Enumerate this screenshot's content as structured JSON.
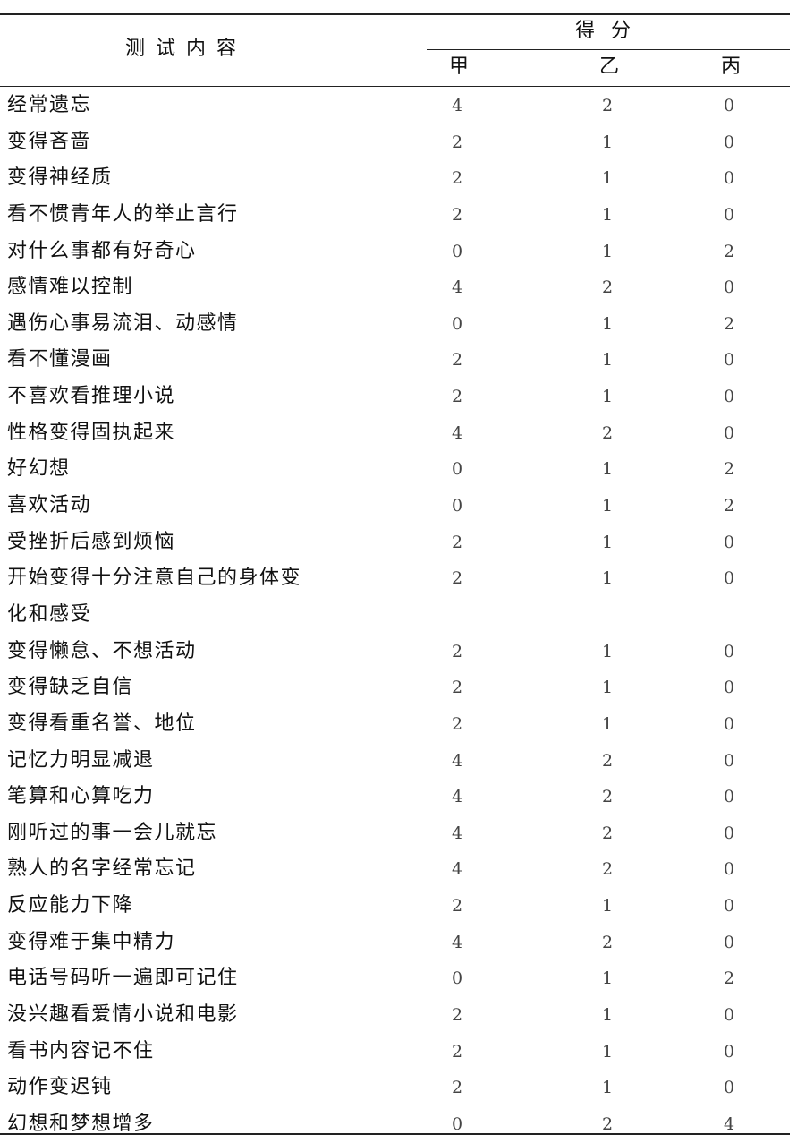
{
  "header": {
    "content_label": "测试内容",
    "score_label": "得分",
    "columns": [
      "甲",
      "乙",
      "丙"
    ]
  },
  "rows": [
    {
      "item": "经常遗忘",
      "jia": "4",
      "yi": "2",
      "bing": "0"
    },
    {
      "item": "变得吝啬",
      "jia": "2",
      "yi": "1",
      "bing": "0"
    },
    {
      "item": "变得神经质",
      "jia": "2",
      "yi": "1",
      "bing": "0"
    },
    {
      "item": "看不惯青年人的举止言行",
      "jia": "2",
      "yi": "1",
      "bing": "0"
    },
    {
      "item": "对什么事都有好奇心",
      "jia": "0",
      "yi": "1",
      "bing": "2"
    },
    {
      "item": "感情难以控制",
      "jia": "4",
      "yi": "2",
      "bing": "0"
    },
    {
      "item": "遇伤心事易流泪、动感情",
      "jia": "0",
      "yi": "1",
      "bing": "2"
    },
    {
      "item": "看不懂漫画",
      "jia": "2",
      "yi": "1",
      "bing": "0"
    },
    {
      "item": "不喜欢看推理小说",
      "jia": "2",
      "yi": "1",
      "bing": "0"
    },
    {
      "item": "性格变得固执起来",
      "jia": "4",
      "yi": "2",
      "bing": "0"
    },
    {
      "item": "好幻想",
      "jia": "0",
      "yi": "1",
      "bing": "2"
    },
    {
      "item": "喜欢活动",
      "jia": "0",
      "yi": "1",
      "bing": "2"
    },
    {
      "item": "受挫折后感到烦恼",
      "jia": "2",
      "yi": "1",
      "bing": "0"
    },
    {
      "item": "开始变得十分注意自己的身体变",
      "item_line2": "化和感受",
      "jia": "2",
      "yi": "1",
      "bing": "0"
    },
    {
      "item": "变得懒怠、不想活动",
      "jia": "2",
      "yi": "1",
      "bing": "0"
    },
    {
      "item": "变得缺乏自信",
      "jia": "2",
      "yi": "1",
      "bing": "0"
    },
    {
      "item": "变得看重名誉、地位",
      "jia": "2",
      "yi": "1",
      "bing": "0"
    },
    {
      "item": "记忆力明显减退",
      "jia": "4",
      "yi": "2",
      "bing": "0"
    },
    {
      "item": "笔算和心算吃力",
      "jia": "4",
      "yi": "2",
      "bing": "0"
    },
    {
      "item": "刚听过的事一会儿就忘",
      "jia": "4",
      "yi": "2",
      "bing": "0"
    },
    {
      "item": "熟人的名字经常忘记",
      "jia": "4",
      "yi": "2",
      "bing": "0"
    },
    {
      "item": "反应能力下降",
      "jia": "2",
      "yi": "1",
      "bing": "0"
    },
    {
      "item": "变得难于集中精力",
      "jia": "4",
      "yi": "2",
      "bing": "0"
    },
    {
      "item": "电话号码听一遍即可记住",
      "jia": "0",
      "yi": "1",
      "bing": "2"
    },
    {
      "item": "没兴趣看爱情小说和电影",
      "jia": "2",
      "yi": "1",
      "bing": "0"
    },
    {
      "item": "看书内容记不住",
      "jia": "2",
      "yi": "1",
      "bing": "0"
    },
    {
      "item": "动作变迟钝",
      "jia": "2",
      "yi": "1",
      "bing": "0"
    },
    {
      "item": "幻想和梦想增多",
      "jia": "0",
      "yi": "2",
      "bing": "4"
    }
  ]
}
